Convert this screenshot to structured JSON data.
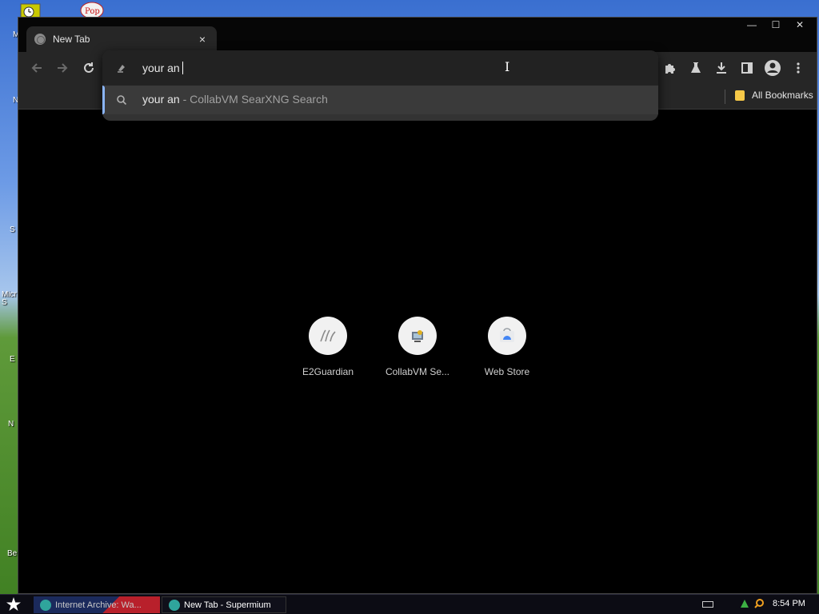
{
  "window": {
    "tab_title": "New Tab",
    "tab_close": "×",
    "minimize": "—",
    "maximize": "☐",
    "close": "✕"
  },
  "toolbar": {
    "back_icon": "arrow-left-icon",
    "forward_icon": "arrow-right-icon",
    "reload_icon": "reload-icon",
    "extensions_icon": "puzzle-icon",
    "labs_icon": "flask-icon",
    "download_icon": "download-icon",
    "side_panel_icon": "side-panel-icon",
    "profile_icon": "profile-icon",
    "menu_icon": "kebab-menu-icon"
  },
  "omnibox": {
    "value": "your an",
    "suggestion_query": "your an",
    "suggestion_rest": " - CollabVM SearXNG Search"
  },
  "bookmarks": {
    "all_bookmarks": "All Bookmarks"
  },
  "shortcuts": [
    {
      "label": "E2Guardian"
    },
    {
      "label": "CollabVM Se..."
    },
    {
      "label": "Web Store"
    }
  ],
  "taskbar": {
    "task1": "Internet Archive: Wa...",
    "task2": "New Tab - Supermium",
    "clock": "8:54 PM"
  },
  "desktop": {
    "labels": [
      "M",
      "N",
      "S",
      "Micr S",
      "E",
      "N",
      "Be"
    ]
  },
  "colors": {
    "accent": "#8ab4f8",
    "toolbar_bg": "#262626",
    "page_bg": "#000000"
  }
}
